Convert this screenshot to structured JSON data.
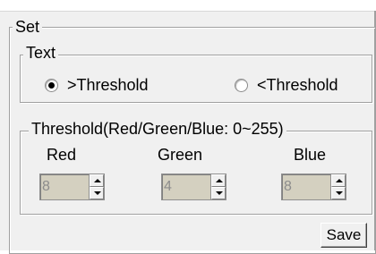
{
  "set_group": {
    "legend": "Set"
  },
  "text_group": {
    "legend": "Text",
    "radio_gt_label": ">Threshold",
    "radio_gt_checked": true,
    "radio_lt_label": "<Threshold",
    "radio_lt_checked": false
  },
  "threshold_group": {
    "legend": "Threshold(Red/Green/Blue: 0~255)",
    "red_label": "Red",
    "green_label": "Green",
    "blue_label": "Blue",
    "red_value": "8",
    "green_value": "4",
    "blue_value": "8"
  },
  "save_label": "Save"
}
